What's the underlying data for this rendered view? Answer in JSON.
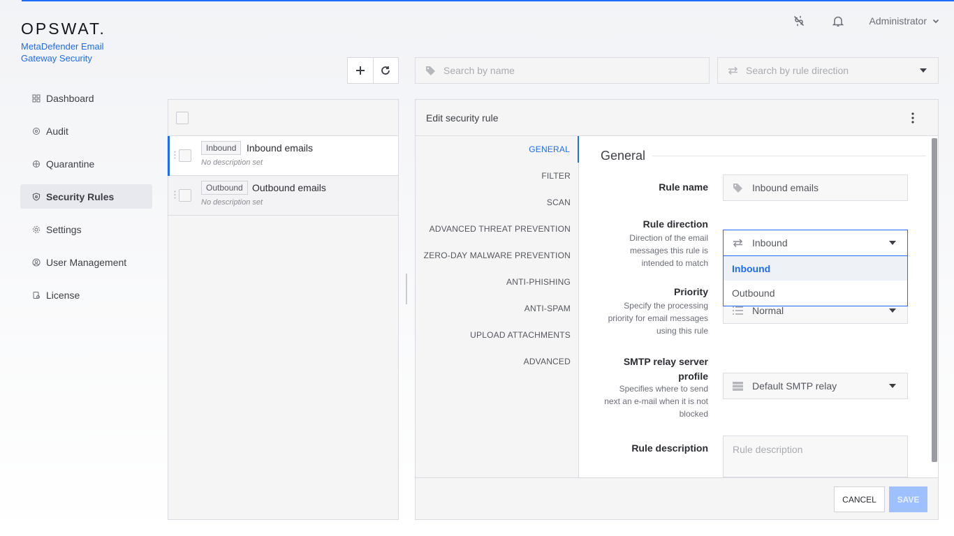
{
  "brand": {
    "logo": "OPSWAT.",
    "product_line1": "MetaDefender Email",
    "product_line2": "Gateway Security"
  },
  "header": {
    "user": "Administrator",
    "icons": [
      "unlink-icon",
      "bell-icon",
      "chevron-down-icon"
    ]
  },
  "sidebar": {
    "items": [
      {
        "label": "Dashboard",
        "icon": "dashboard-icon"
      },
      {
        "label": "Audit",
        "icon": "audit-icon"
      },
      {
        "label": "Quarantine",
        "icon": "quarantine-icon"
      },
      {
        "label": "Security Rules",
        "icon": "shield-icon",
        "active": true
      },
      {
        "label": "Settings",
        "icon": "gear-icon"
      },
      {
        "label": "User Management",
        "icon": "user-icon"
      },
      {
        "label": "License",
        "icon": "license-icon"
      }
    ]
  },
  "toolbar": {
    "search_name_placeholder": "Search by name",
    "search_direction_placeholder": "Search by rule direction"
  },
  "rules": [
    {
      "tag": "Inbound",
      "name": "Inbound emails",
      "description": "No description set",
      "selected": true
    },
    {
      "tag": "Outbound",
      "name": "Outbound emails",
      "description": "No description set",
      "selected": false
    }
  ],
  "editor": {
    "title": "Edit security rule",
    "tabs": [
      "GENERAL",
      "FILTER",
      "SCAN",
      "ADVANCED THREAT PREVENTION",
      "ZERO-DAY MALWARE PREVENTION",
      "ANTI-PHISHING",
      "ANTI-SPAM",
      "UPLOAD ATTACHMENTS",
      "ADVANCED"
    ],
    "active_tab": "GENERAL",
    "section_title": "General",
    "fields": {
      "rule_name": {
        "label": "Rule name",
        "value": "Inbound emails"
      },
      "rule_direction": {
        "label": "Rule direction",
        "help_line1": "Direction of the email",
        "help_line2": "messages this rule is",
        "help_line3": "intended to match",
        "value": "Inbound",
        "options": [
          "Inbound",
          "Outbound"
        ]
      },
      "priority": {
        "label": "Priority",
        "help_line1": "Specify the processing",
        "help_line2": "priority for email messages",
        "help_line3": "using this rule",
        "value": "Normal"
      },
      "smtp": {
        "label_line1": "SMTP relay server",
        "label_line2": "profile",
        "help_line1": "Specifies where to send",
        "help_line2": "next an e-mail when it is not",
        "help_line3": "blocked",
        "value": "Default SMTP relay"
      },
      "description": {
        "label": "Rule description",
        "placeholder": "Rule description"
      }
    },
    "cancel_label": "CANCEL",
    "save_label": "SAVE"
  },
  "colors": {
    "accent": "#1d6bfc",
    "save_disabled": "#9ec0ff"
  }
}
